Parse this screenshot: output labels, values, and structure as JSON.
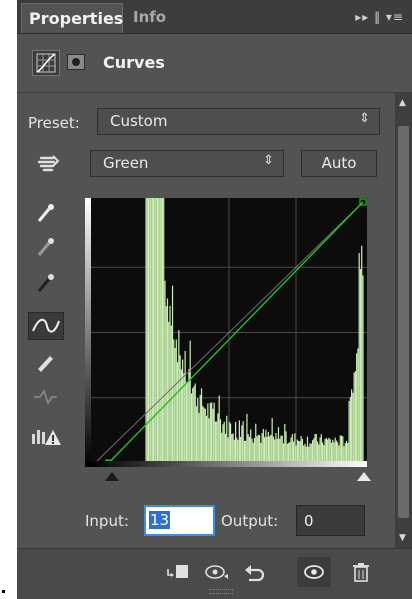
{
  "tabs": {
    "properties": "Properties",
    "info": "Info",
    "controls": "▸▸ ‖ ▾≡"
  },
  "header": {
    "title": "Curves"
  },
  "preset": {
    "label": "Preset:",
    "value": "Custom",
    "arrow": "⇕"
  },
  "channel": {
    "value": "Green",
    "arrow": "⇕",
    "auto_label": "Auto"
  },
  "io": {
    "input_label": "Input:",
    "input_value": "13",
    "output_label": "Output:",
    "output_value": "0"
  },
  "tools": [
    "target-adjust-icon",
    "white-point-eyedropper-icon",
    "gray-point-eyedropper-icon",
    "black-point-eyedropper-icon",
    "curve-point-tool-icon",
    "pencil-draw-icon",
    "smooth-curve-icon",
    "clipping-warning-icon"
  ],
  "bottom_icons": [
    "clip-to-layer-icon",
    "view-previous-state-icon",
    "reset-icon",
    "visibility-eye-icon",
    "trash-icon"
  ],
  "colors": {
    "panel": "#535353",
    "curve": "#22c122",
    "histogram": "#ccf0b4",
    "input_highlight": "#2f6fd1"
  },
  "chart_data": {
    "type": "area",
    "curve_points": [
      [
        13,
        0
      ],
      [
        255,
        255
      ]
    ],
    "histogram_description": "green channel histogram: tall spikes around input 50-65, decaying, rising at 240-255",
    "xlim": [
      0,
      255
    ],
    "ylim": [
      0,
      255
    ]
  }
}
